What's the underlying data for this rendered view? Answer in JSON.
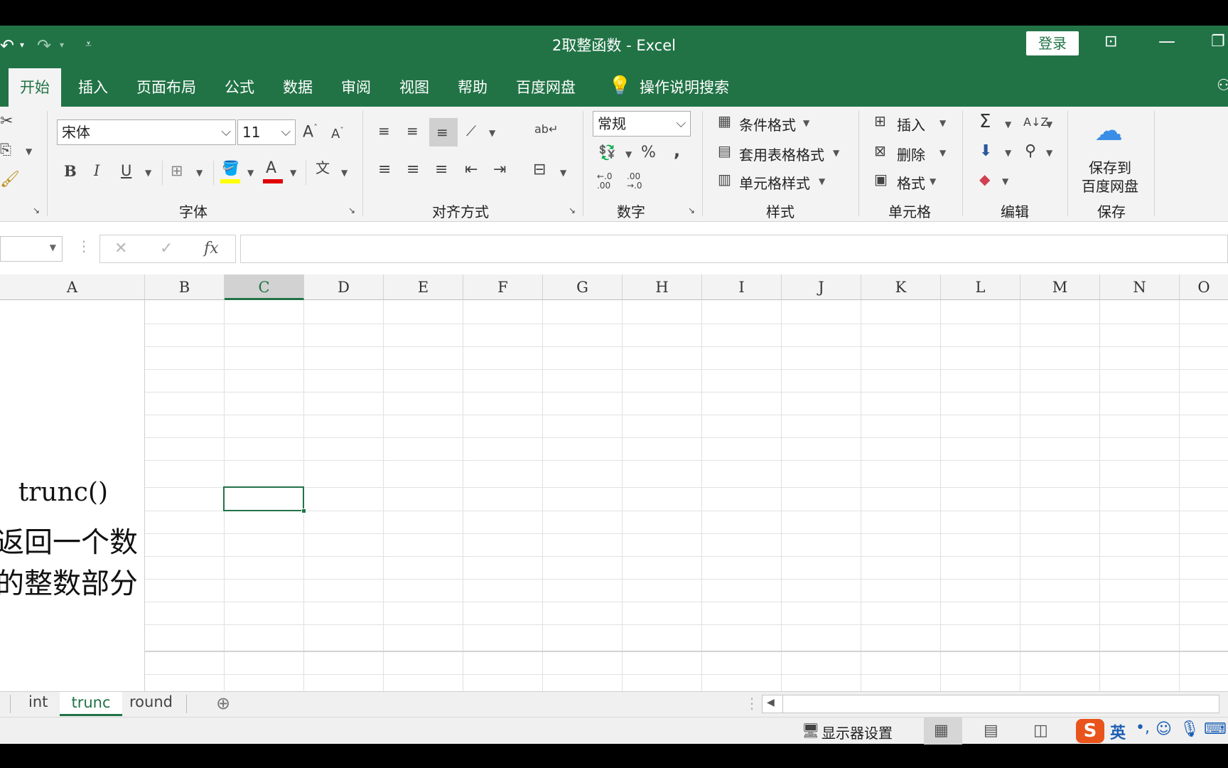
{
  "window": {
    "title": "2取整函数  -  Excel",
    "login_label": "登录"
  },
  "ribbon_tabs": [
    "开始",
    "插入",
    "页面布局",
    "公式",
    "数据",
    "审阅",
    "视图",
    "帮助",
    "百度网盘"
  ],
  "tell_me": "操作说明搜索",
  "font": {
    "name": "宋体",
    "size": "11",
    "bold": "B",
    "italic": "I",
    "underline": "U",
    "group_label": "字体"
  },
  "alignment": {
    "group_label": "对齐方式"
  },
  "number": {
    "format": "常规",
    "percent": "%",
    "comma": ",",
    "inc_decimal": "←.0 .00",
    "dec_decimal": ".00 →.0",
    "group_label": "数字"
  },
  "styles": {
    "conditional": "条件格式",
    "table_format": "套用表格格式",
    "cell_styles": "单元格样式",
    "group_label": "样式"
  },
  "cells": {
    "insert": "插入",
    "delete": "删除",
    "format": "格式",
    "group_label": "单元格"
  },
  "editing": {
    "group_label": "编辑"
  },
  "save": {
    "button_line1": "保存到",
    "button_line2": "百度网盘",
    "group_label": "保存"
  },
  "formula_bar": {
    "fx": "fx",
    "content": ""
  },
  "columns": [
    "A",
    "B",
    "C",
    "D",
    "E",
    "F",
    "G",
    "H",
    "I",
    "J",
    "K",
    "L",
    "M",
    "N",
    "O"
  ],
  "selected_column": "C",
  "cell_text": {
    "line1": "trunc()",
    "line2": "返回一个数",
    "line3": "的整数部分"
  },
  "sheet_tabs": [
    "int",
    "trunc",
    "round"
  ],
  "active_sheet": "trunc",
  "status": {
    "display_settings": "显示器设置",
    "ime": "英"
  }
}
